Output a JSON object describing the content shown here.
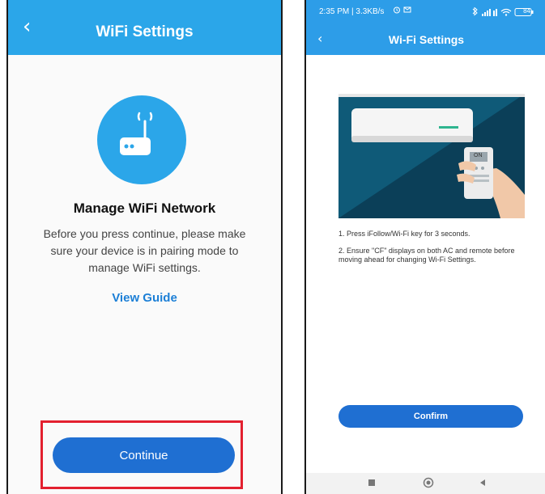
{
  "left": {
    "header": {
      "back_icon": "chevron-left-icon",
      "title": "WiFi Settings",
      "bg_color": "#2ba6e9"
    },
    "router_icon": "router-wifi-icon",
    "heading": "Manage WiFi Network",
    "body": "Before you press continue, please make sure your device is in pairing mode to manage WiFi settings.",
    "view_guide": "View Guide",
    "continue_label": "Continue",
    "highlight_color": "#e3202f"
  },
  "right": {
    "status_bar": {
      "time": "2:35 PM | 3.3KB/s",
      "icons": [
        "alarm-icon",
        "message-icon",
        "bluetooth-icon",
        "signal-icon",
        "wifi-icon",
        "battery-icon"
      ],
      "battery": "84"
    },
    "header": {
      "back_icon": "chevron-left-icon",
      "title": "Wi-Fi Settings"
    },
    "illustration": "ac-remote-illustration",
    "remote_button_text": "ON",
    "instructions": [
      "1. Press iFollow/Wi-Fi key for 3 seconds.",
      "2. Ensure \"CF\" displays on both AC and remote before moving ahead for changing Wi-Fi Settings."
    ],
    "confirm_label": "Confirm",
    "nav": [
      "recent-apps-icon",
      "home-icon",
      "back-icon"
    ]
  }
}
